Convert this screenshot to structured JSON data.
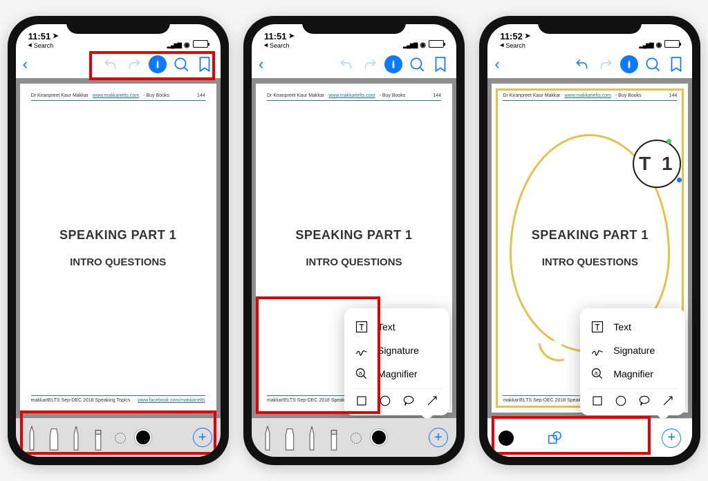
{
  "status": {
    "time1": "11:51",
    "time2": "11:51",
    "time3": "11:52",
    "nav_arrow": "◂",
    "search": "Search",
    "loc_arrow": "➤"
  },
  "doc": {
    "author": "Dr Kiranpreet Kaur Makkar",
    "site": "www.makkarielts.com",
    "buy": "- Buy Books",
    "pg": "144",
    "h1": "SPEAKING PART 1",
    "h2": "INTRO QUESTIONS",
    "foot_left": "makkarIELTS Sep-DEC 2018 Speaking Topics",
    "foot_right": "www.facebook.com/makkarielts"
  },
  "popover": {
    "text": "Text",
    "signature": "Signature",
    "magnifier": "Magnifier"
  },
  "magnifier_text": "T 1"
}
